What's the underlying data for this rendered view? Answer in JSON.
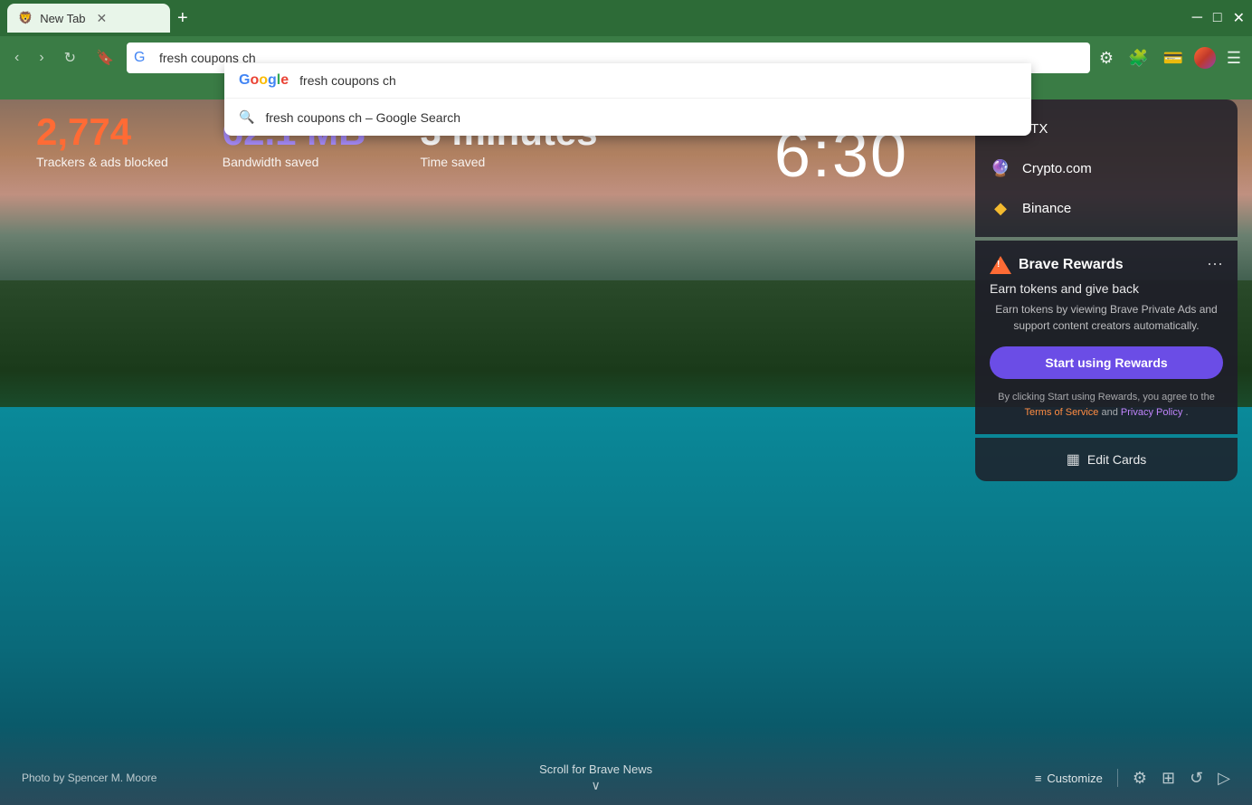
{
  "browser": {
    "tab_title": "New Tab",
    "new_tab_symbol": "+",
    "window_controls": {
      "minimize": "─",
      "maximize": "□",
      "close": "✕"
    }
  },
  "toolbar": {
    "back_label": "‹",
    "forward_label": "›",
    "reload_label": "↻",
    "bookmark_label": "🔖",
    "address_value": "fresh coupons ch",
    "settings_label": "⚙",
    "extensions_label": "🧩",
    "wallet_label": "💳"
  },
  "search_dropdown": {
    "input_text": "fresh coupons ch",
    "suggestion_text": "fresh coupons ch – Google Search"
  },
  "stats": {
    "trackers_count": "2,774",
    "trackers_label": "Trackers & ads blocked",
    "bandwidth_count": "62.1 MB",
    "bandwidth_label": "Bandwidth saved",
    "time_count": "3 minutes",
    "time_label": "Time saved"
  },
  "clock": {
    "time": "6:30"
  },
  "crypto_links": [
    {
      "name": "FTX",
      "icon": "FTX"
    },
    {
      "name": "Crypto.com",
      "icon": "🔮"
    },
    {
      "name": "Binance",
      "icon": "◆"
    }
  ],
  "brave_rewards": {
    "title": "Brave Rewards",
    "subtitle": "Earn tokens and give back",
    "description": "Earn tokens by viewing Brave Private Ads and support content creators automatically.",
    "button_label": "Start using Rewards",
    "footer_text": "By clicking Start using Rewards, you agree to the ",
    "terms_label": "Terms of Service",
    "and_text": " and ",
    "privacy_label": "Privacy Policy",
    "period": "."
  },
  "edit_cards": {
    "label": "Edit Cards",
    "icon": "▦"
  },
  "bottom": {
    "photo_credit": "Photo by Spencer M. Moore",
    "scroll_text": "Scroll for Brave News",
    "scroll_arrow": "˅",
    "customize_label": "Customize",
    "customize_icon": "≡"
  }
}
